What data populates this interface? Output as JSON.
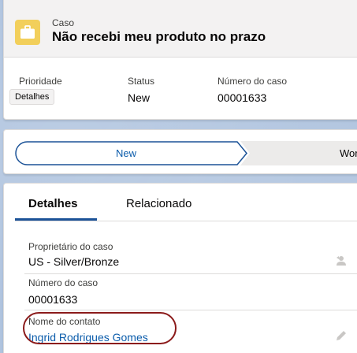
{
  "header": {
    "object_label": "Caso",
    "title": "Não recebi meu produto no prazo",
    "highlights": [
      {
        "label": "Prioridade",
        "value": ""
      },
      {
        "label": "Status",
        "value": "New"
      },
      {
        "label": "Número do caso",
        "value": "00001633"
      }
    ],
    "detalhes_button": "Detalhes"
  },
  "path": {
    "current": "New",
    "next_partial": "Wor"
  },
  "tabs": [
    {
      "label": "Detalhes",
      "active": true
    },
    {
      "label": "Relacionado",
      "active": false
    }
  ],
  "fields": [
    {
      "label": "Proprietário do caso",
      "value": "US - Silver/Bronze"
    },
    {
      "label": "Número do caso",
      "value": "00001633"
    },
    {
      "label": "Nome do contato",
      "value": "Ingrid Rodrigues Gomes"
    }
  ],
  "colors": {
    "case_icon": "#f2cf5b",
    "link": "#0b5cab",
    "highlight_annotation": "#8b1a1a"
  },
  "icons": [
    "briefcase-icon",
    "change-owner-icon",
    "pencil-icon"
  ]
}
